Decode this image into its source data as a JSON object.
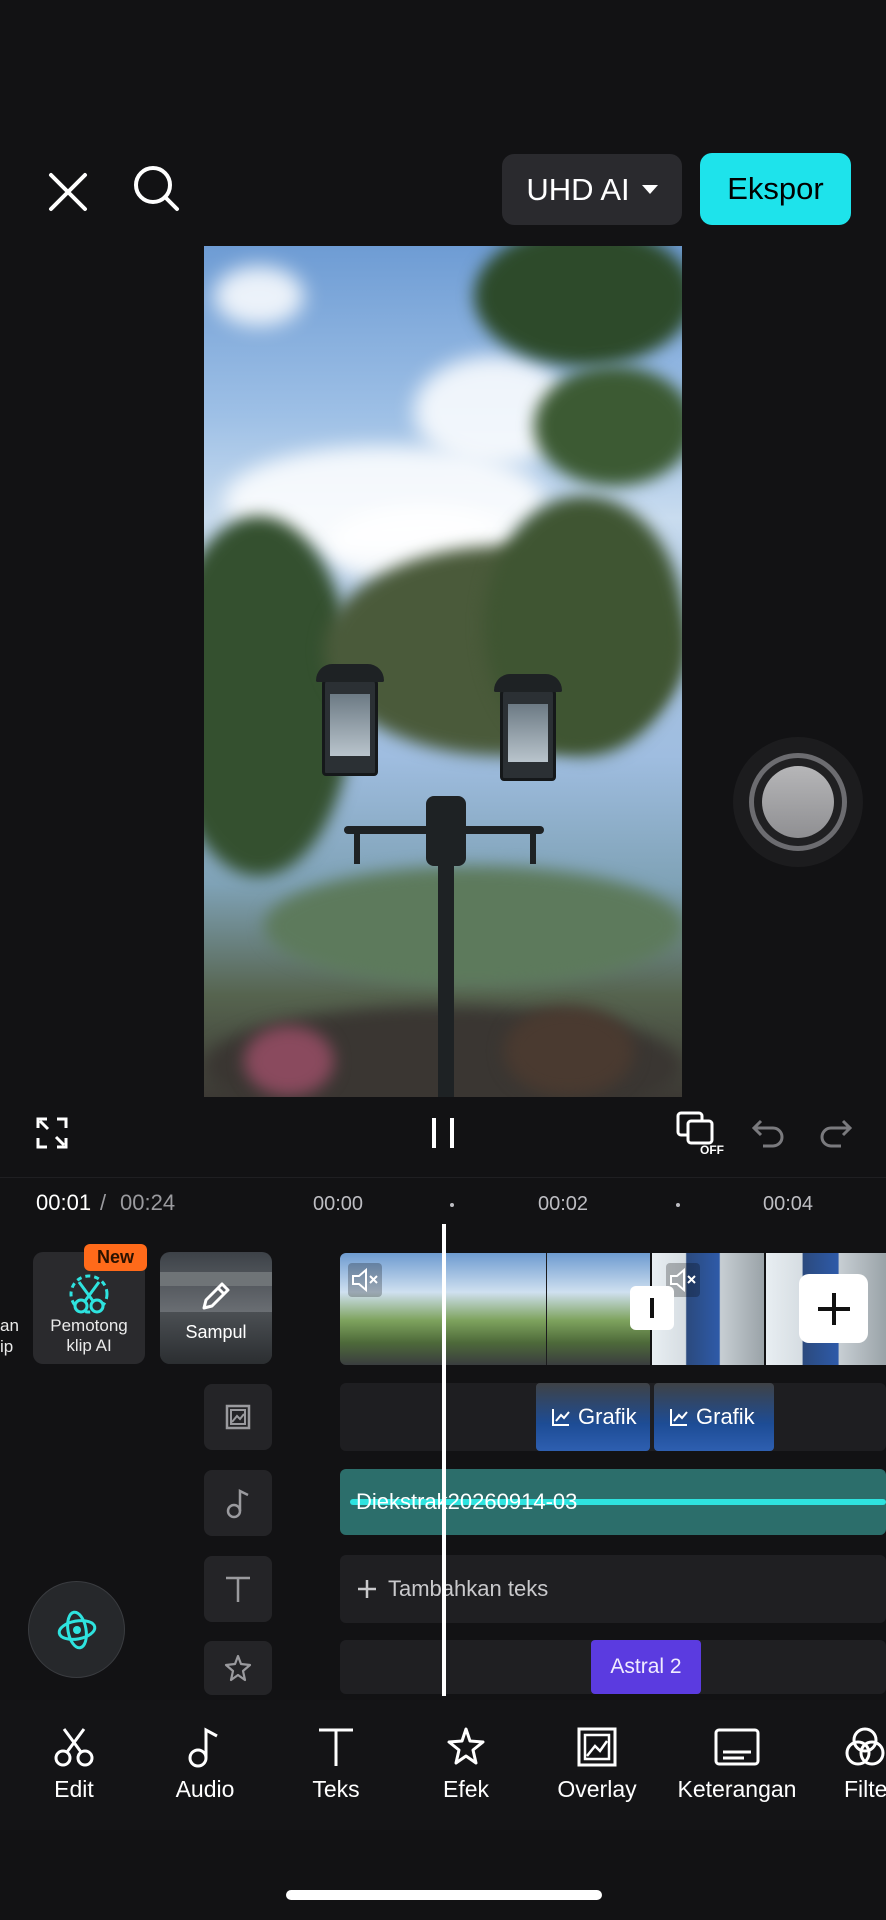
{
  "top_bar": {
    "close_icon": "close-icon",
    "search_icon": "search-icon",
    "quality_label": "UHD AI",
    "export_label": "Ekspor",
    "export_color": "#1ee3eb"
  },
  "preview_controls": {
    "fullscreen_icon": "expand-icon",
    "pause_icon": "pause-icon",
    "keyframe_icon": "keyframe-off-icon",
    "keyframe_badge": "OFF",
    "undo_icon": "undo-icon",
    "redo_icon": "redo-icon"
  },
  "timeline": {
    "current_time": "00:01",
    "separator": "/",
    "total_time": "00:24",
    "ticks": [
      "00:00",
      "00:02",
      "00:04"
    ]
  },
  "left_tools": {
    "partial_label_1": "an",
    "partial_label_2": "ip",
    "ai_cut": {
      "badge": "New",
      "label_line1": "Pemotong",
      "label_line2": "klip AI"
    },
    "cover_label": "Sampul"
  },
  "tracks": {
    "overlay_clips": [
      "Grafik",
      "Grafik"
    ],
    "audio_clip": "Diekstrak20260914-03",
    "add_text": "Tambahkan teks",
    "effect_clip": "Astral 2",
    "effect_color": "#5b3be0",
    "audio_color": "#2c6e6b"
  },
  "toolbar": {
    "items": [
      {
        "label": "Edit",
        "icon": "scissors-icon"
      },
      {
        "label": "Audio",
        "icon": "music-note-icon"
      },
      {
        "label": "Teks",
        "icon": "text-icon"
      },
      {
        "label": "Efek",
        "icon": "sparkle-star-icon"
      },
      {
        "label": "Overlay",
        "icon": "overlay-icon"
      },
      {
        "label": "Keterangan",
        "icon": "captions-icon"
      },
      {
        "label": "Filte",
        "icon": "filter-icon"
      }
    ]
  }
}
